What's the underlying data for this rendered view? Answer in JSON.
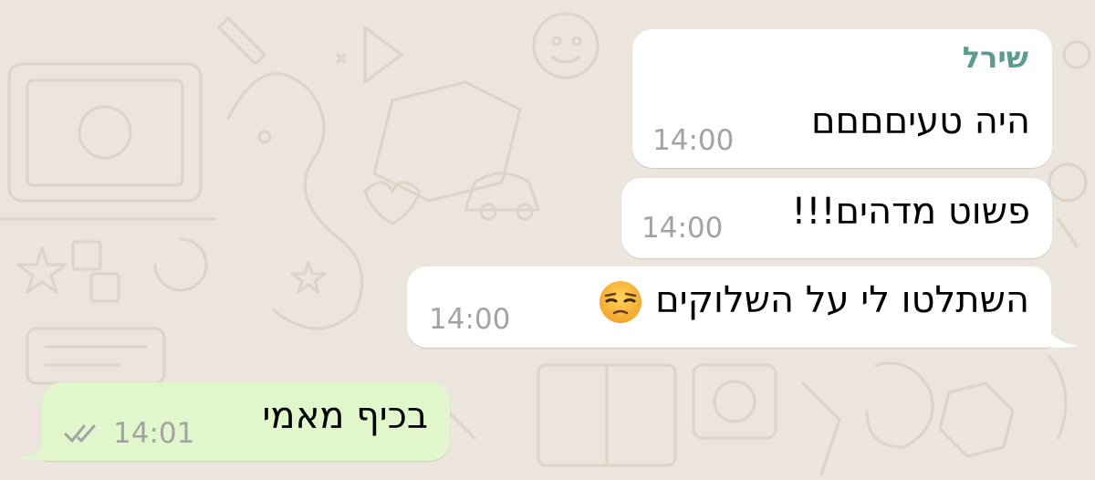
{
  "chat": {
    "messages": [
      {
        "direction": "incoming",
        "sender": "שירל",
        "text": "היה טעיםםםם",
        "time": "14:00"
      },
      {
        "direction": "incoming",
        "text": "פשוט מדהים!!!",
        "time": "14:00"
      },
      {
        "direction": "incoming",
        "text": "השתלטו לי על השלוקים",
        "emoji": "unamused-face-icon",
        "time": "14:00"
      },
      {
        "direction": "outgoing",
        "text": "בכיף מאמי",
        "time": "14:01",
        "status": "delivered-double-check-icon"
      }
    ]
  },
  "colors": {
    "background": "#ece5dd",
    "incoming_bubble": "#ffffff",
    "outgoing_bubble": "#e1f7cb",
    "sender_name": "#5a9c8e",
    "timestamp": "#a3a3a3",
    "ticks": "#a3a3a3"
  }
}
